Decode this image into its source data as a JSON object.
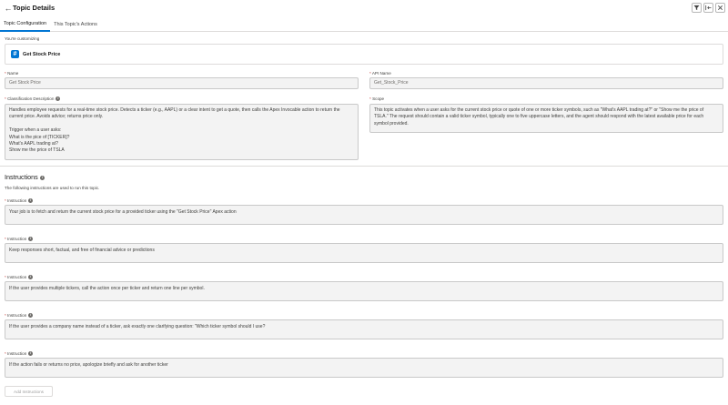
{
  "header": {
    "title": "Topic Details",
    "back_icon": "arrow-left-icon",
    "buttons": [
      "filter-icon",
      "split-view-icon",
      "close-icon"
    ]
  },
  "tabs": [
    {
      "label": "Topic Configuration",
      "active": true
    },
    {
      "label": "This Topic's Actions",
      "active": false
    }
  ],
  "customizing": {
    "label": "You're customizing",
    "topic_name": "Get Stock Price"
  },
  "fields": {
    "name": {
      "label": "Name",
      "value": "Get Stock Price"
    },
    "api_name": {
      "label": "API Name",
      "value": "Get_Stock_Price"
    },
    "classification": {
      "label": "Classification Description",
      "value": "Handles employee requests for a real-time stock price. Detects a ticker (e.g., AAPL) or a clear intent to get a quote, then calls the Apex Invocable action to return the current price. Avoids advice; returns price only.\n\nTrigger when a user asks:\nWhat is the pice of [TICKER]?\nWhat's AAPL trading at?\nShow me the price of TSLA"
    },
    "scope": {
      "label": "Scope",
      "value": "This topic activates when a user asks for the current stock price or quote of one or more ticker symbols, such as \"What's AAPL trading at?\" or \"Show me the price of TSLA.\" The request should contain a valid ticker symbol, typically one to five uppercase letters, and the agent should respond with the latest available price for each symbol provided."
    }
  },
  "instructions": {
    "title": "Instructions",
    "subtitle": "The following instructions are used to run this topic.",
    "item_label": "Instruction",
    "items": [
      "Your job is to fetch and return the current stock price for a provided ticker using the \"Get Stock Price\" Apex action",
      "Keep responses short, factual, and free of financial advice or predictions",
      "If the user provides multiple tickers, call the action once per ticker and return one line per symbol.",
      "If the user provides a company name instead of a ticker, ask exactly one clarifying question: \"Which ticker symbol should I use?",
      "If the action fails or returns no price, apologize briefly and ask for another ticker"
    ],
    "add_button": "Add Instructions"
  },
  "colors": {
    "accent": "#0176d3",
    "required": "#c23934",
    "field_bg": "#f3f3f3"
  }
}
